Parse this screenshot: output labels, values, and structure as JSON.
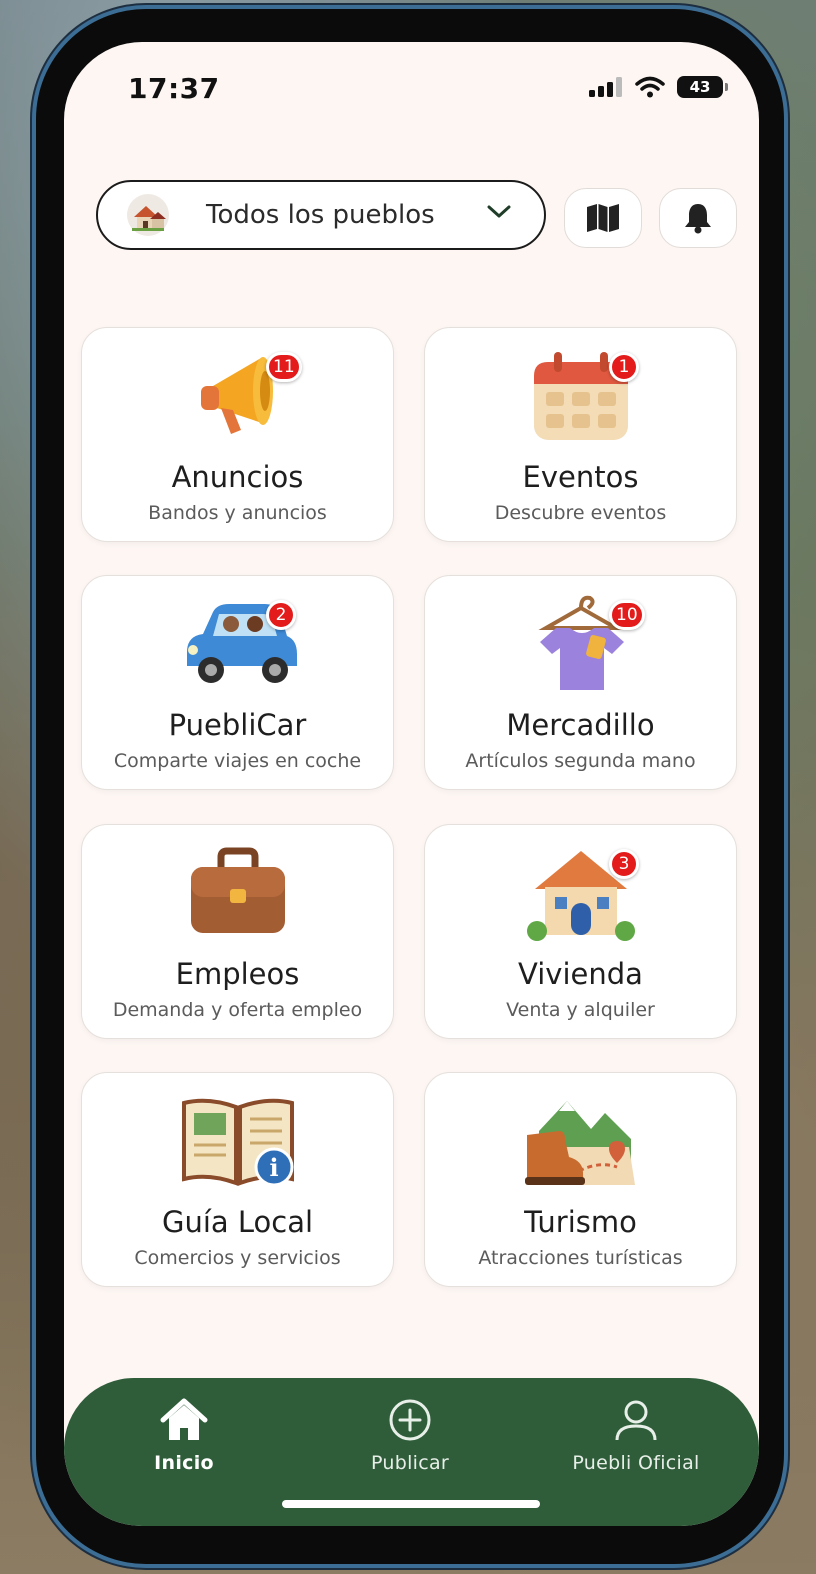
{
  "status_bar": {
    "time": "17:37",
    "battery": "43"
  },
  "header": {
    "town_selector_label": "Todos los pueblos"
  },
  "cards": [
    {
      "title": "Anuncios",
      "subtitle": "Bandos y anuncios",
      "badge": "11",
      "icon": "megaphone-icon"
    },
    {
      "title": "Eventos",
      "subtitle": "Descubre eventos",
      "badge": "1",
      "icon": "calendar-icon"
    },
    {
      "title": "PuebliCar",
      "subtitle": "Comparte viajes en coche",
      "badge": "2",
      "icon": "car-icon"
    },
    {
      "title": "Mercadillo",
      "subtitle": "Artículos segunda mano",
      "badge": "10",
      "icon": "shirt-hanger-icon"
    },
    {
      "title": "Empleos",
      "subtitle": "Demanda y oferta empleo",
      "badge": "",
      "icon": "briefcase-icon"
    },
    {
      "title": "Vivienda",
      "subtitle": "Venta y alquiler",
      "badge": "3",
      "icon": "house-icon"
    },
    {
      "title": "Guía Local",
      "subtitle": "Comercios y servicios",
      "badge": "",
      "icon": "guide-book-icon"
    },
    {
      "title": "Turismo",
      "subtitle": "Atracciones turísticas",
      "badge": "",
      "icon": "hiking-boot-icon"
    }
  ],
  "nav": {
    "items": [
      {
        "label": "Inicio",
        "icon": "home-icon",
        "active": true
      },
      {
        "label": "Publicar",
        "icon": "plus-circle-icon",
        "active": false
      },
      {
        "label": "Puebli Oficial",
        "icon": "user-icon",
        "active": false
      }
    ]
  },
  "colors": {
    "nav_bg": "#2f5d3a",
    "badge": "#e31b1b",
    "screen_bg": "#fdf6f3"
  }
}
